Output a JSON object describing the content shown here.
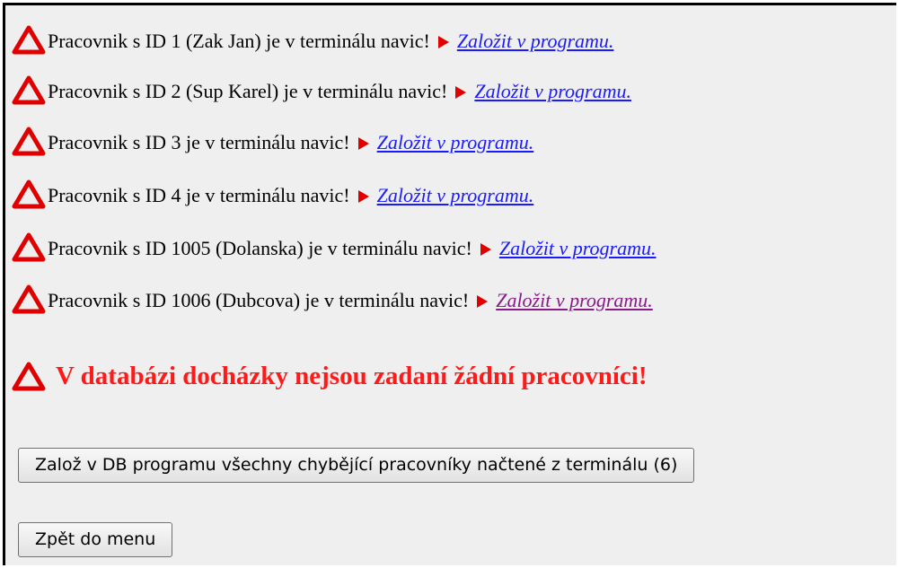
{
  "warnings": [
    {
      "message": "Pracovnik s ID 1 (Zak Jan) je v terminálu navic!",
      "link": "Založit v programu.",
      "visited": false
    },
    {
      "message": "Pracovnik s ID 2 (Sup Karel) je v terminálu navic!",
      "link": "Založit v programu.",
      "visited": false
    },
    {
      "message": "Pracovnik s ID 3 je v terminálu navic!",
      "link": "Založit v programu.",
      "visited": false
    },
    {
      "message": "Pracovnik s ID 4 je v terminálu navic!",
      "link": "Založit v programu.",
      "visited": false
    },
    {
      "message": "Pracovnik s ID 1005 (Dolanska) je v terminálu navic!",
      "link": "Založit v programu.",
      "visited": false
    },
    {
      "message": "Pracovnik s ID 1006 (Dubcova) je v terminálu navic!",
      "link": "Založit v programu.",
      "visited": true
    }
  ],
  "error_message": "V databázi docházky nejsou zadaní žádní pracovníci!",
  "buttons": {
    "create_all": "Založ v DB programu všechny chybějící pracovníky načtené z terminálu (6)",
    "back": "Zpět do menu"
  },
  "icons": {
    "warning": "warning-triangle-icon",
    "arrow": "red-play-arrow-icon"
  },
  "colors": {
    "warning_icon": "#e00000",
    "arrow": "#e00000",
    "link": "#1a1aff",
    "link_visited": "#8a1a8a",
    "error_text": "#ff1a1a",
    "background": "#efefef"
  }
}
